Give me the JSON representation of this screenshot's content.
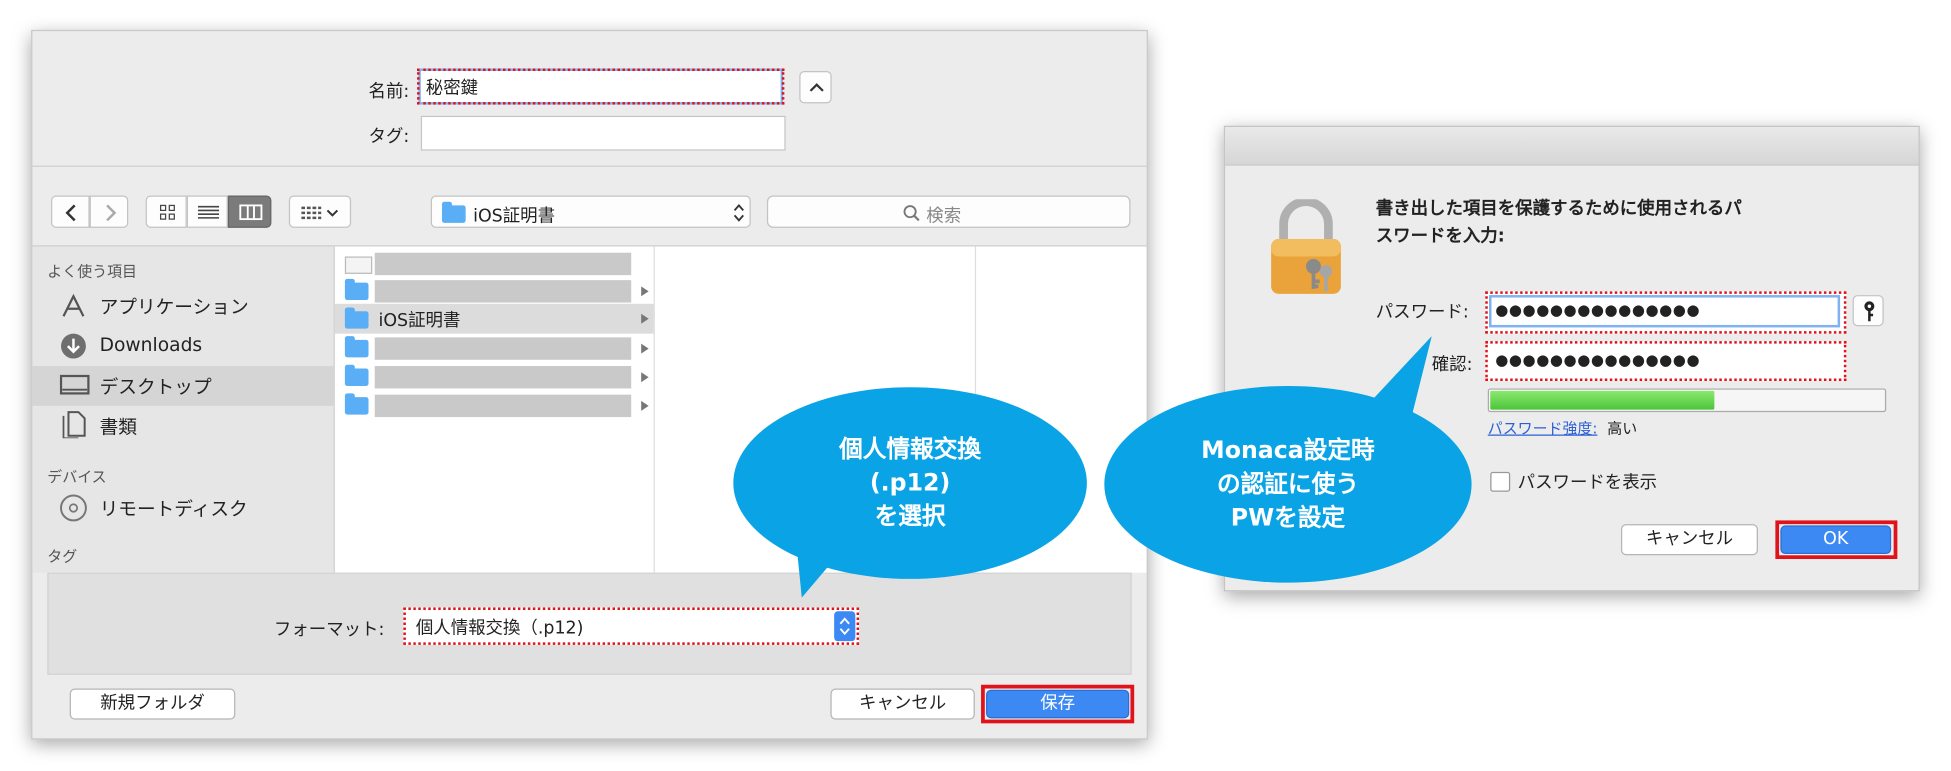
{
  "save_dialog": {
    "name_label": "名前:",
    "name_value": "秘密鍵",
    "tag_label": "タグ:",
    "tag_value": "",
    "path_folder": "iOS証明書",
    "search_placeholder": "検索",
    "sidebar": {
      "favorites_header": "よく使う項目",
      "items": [
        {
          "label": "アプリケーション",
          "icon": "applications-icon"
        },
        {
          "label": "Downloads",
          "icon": "downloads-icon"
        },
        {
          "label": "デスクトップ",
          "icon": "desktop-icon"
        },
        {
          "label": "書類",
          "icon": "documents-icon"
        }
      ],
      "devices_header": "デバイス",
      "device_items": [
        {
          "label": "リモートディスク",
          "icon": "remote-disc-icon"
        }
      ],
      "tags_header": "タグ"
    },
    "file_list": {
      "selected_folder": "iOS証明書"
    },
    "format_label": "フォーマット:",
    "format_value": "個人情報交換（.p12)",
    "new_folder_button": "新規フォルダ",
    "cancel_button": "キャンセル",
    "save_button": "保存"
  },
  "password_dialog": {
    "message": "書き出した項目を保護するために使用されるパスワードを入力:",
    "password_label": "パスワード:",
    "password_value": "●●●●●●●●●●●●●●●",
    "verify_label": "確認:",
    "verify_value": "●●●●●●●●●●●●●●●",
    "strength_label": "パスワード強度:",
    "strength_value": "高い",
    "strength_level": 0.57,
    "show_password_label": "パスワードを表示",
    "show_password_checked": false,
    "cancel_button": "キャンセル",
    "ok_button": "OK"
  },
  "callouts": {
    "left_lines": [
      "個人情報交換",
      "(.p12)",
      "を選択"
    ],
    "right_lines": [
      "Monaca設定時",
      "の認証に使う",
      "PWを設定"
    ]
  },
  "colors": {
    "highlight_red": "#e0131b",
    "callout_blue": "#0aa4e6",
    "accent_blue": "#3d89f3",
    "strength_green": "#5fd34c"
  }
}
